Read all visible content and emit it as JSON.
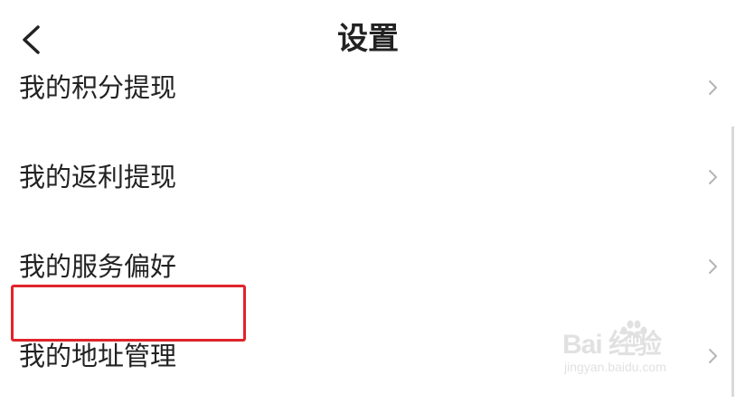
{
  "header": {
    "title": "设置",
    "back_icon": "chevron-left-icon"
  },
  "items": [
    {
      "label": "我的积分提现",
      "icon": "chevron-right-icon"
    },
    {
      "label": "我的返利提现",
      "icon": "chevron-right-icon"
    },
    {
      "label": "我的服务偏好",
      "icon": "chevron-right-icon"
    },
    {
      "label": "我的地址管理",
      "icon": "chevron-right-icon",
      "highlighted": true
    }
  ],
  "highlight_color": "#e0242b",
  "watermark": {
    "logo_text": "Bai  经验",
    "url": "jingyan.baidu.com"
  }
}
